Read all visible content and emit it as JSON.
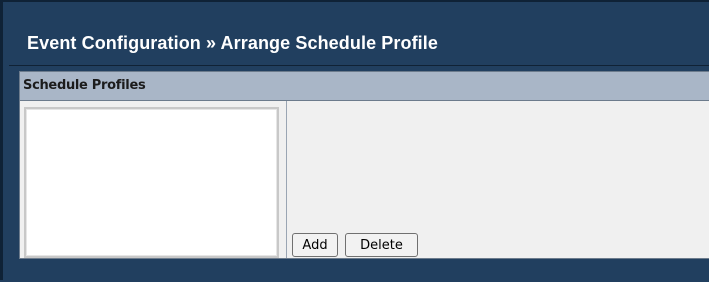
{
  "header": {
    "title": "Event Configuration » Arrange Schedule Profile"
  },
  "panel": {
    "heading": "Schedule Profiles",
    "listbox": {
      "items": []
    },
    "buttons": {
      "add_label": "Add",
      "delete_label": "Delete"
    }
  },
  "colors": {
    "page_background": "#213f5f",
    "panel_header": "#a9b6c7",
    "panel_background": "#f0f0f0"
  }
}
